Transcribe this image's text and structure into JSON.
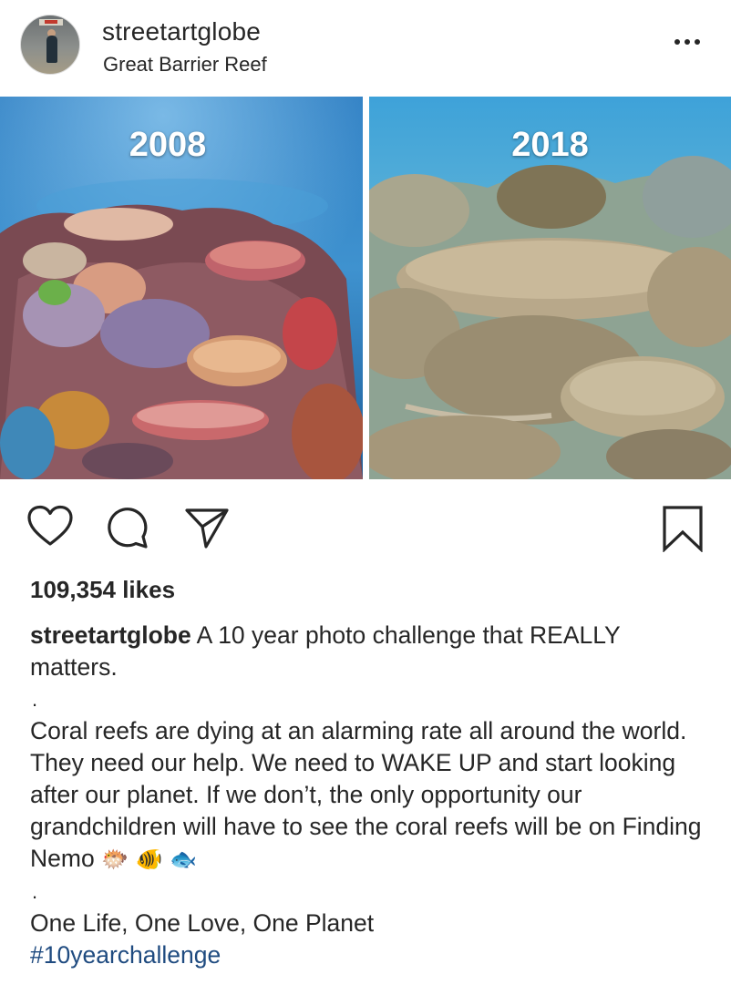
{
  "header": {
    "username": "streetartglobe",
    "location": "Great Barrier Reef",
    "more_icon": "ellipsis-icon"
  },
  "photos": {
    "left_label": "2008",
    "right_label": "2018"
  },
  "actions": {
    "icons": [
      "heart-icon",
      "comment-icon",
      "share-icon",
      "bookmark-icon"
    ]
  },
  "likes": "109,354 likes",
  "caption": {
    "username": "streetartglobe",
    "line1": " A 10 year photo challenge that REALLY matters.",
    "dot1": ".",
    "body": "Coral reefs are dying at an alarming rate all around the world. They need our help. We need to WAKE UP and start looking after our planet. If we don’t, the only opportunity our grandchildren will have to see the coral reefs will be on Finding Nemo",
    "emojis": "🐡 🐠 🐟",
    "dot2": ".",
    "tagline": "One Life, One Love, One Planet",
    "hashtag": "#10yearchallenge"
  },
  "colors": {
    "text": "#262626",
    "hashtag": "#1f4b80",
    "background": "#ffffff"
  }
}
